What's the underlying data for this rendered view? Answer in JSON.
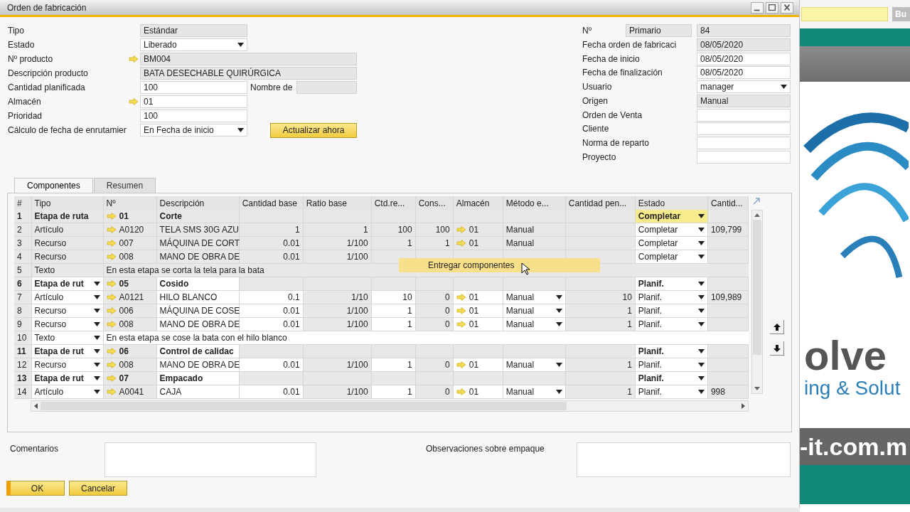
{
  "window": {
    "title": "Orden de fabricación"
  },
  "header_left": [
    {
      "label": "Tipo",
      "value": "Estándar",
      "editable": false
    },
    {
      "label": "Estado",
      "value": "Liberado",
      "editable": true,
      "dropdown": true
    },
    {
      "label": "Nº producto",
      "value": "BM004",
      "editable": false,
      "link": true,
      "wide": true
    },
    {
      "label": "Descripción producto",
      "value": "BATA DESECHABLE QUIRÚRGICA",
      "editable": false,
      "wide": true
    },
    {
      "label": "Cantidad planificada",
      "value": "100",
      "editable": true,
      "extra_label": "Nombre de"
    },
    {
      "label": "Almacén",
      "value": "01",
      "editable": true,
      "link": true
    },
    {
      "label": "Prioridad",
      "value": "100",
      "editable": true
    },
    {
      "label": "Cálculo de fecha de enrutamier",
      "value": "En Fecha de inicio",
      "editable": true,
      "dropdown": true,
      "button": "Actualizar ahora"
    }
  ],
  "header_right": [
    {
      "label": "Nº",
      "series": "Primario",
      "value": "84",
      "editable": false
    },
    {
      "label": "Fecha orden de fabricaci",
      "value": "08/05/2020",
      "editable": false
    },
    {
      "label": "Fecha de inicio",
      "value": "08/05/2020",
      "editable": true
    },
    {
      "label": "Fecha de finalización",
      "value": "08/05/2020",
      "editable": true
    },
    {
      "label": "Usuario",
      "value": "manager",
      "editable": true,
      "dropdown": true
    },
    {
      "label": "Origen",
      "value": "Manual",
      "editable": false
    },
    {
      "label": "Orden de Venta",
      "editable": true
    },
    {
      "label": "Cliente",
      "editable": true
    },
    {
      "label": "Norma de reparto",
      "editable": true
    },
    {
      "label": "Proyecto",
      "editable": true
    }
  ],
  "tabs": [
    {
      "label": "Componentes",
      "selected": true
    },
    {
      "label": "Resumen",
      "selected": false
    }
  ],
  "table": {
    "columns": [
      "#",
      "Tipo",
      "Nº",
      "Descripción",
      "Cantidad base",
      "Ratio base",
      "Ctd.re...",
      "Cons...",
      "Almacén",
      "Método e...",
      "Cantidad pen...",
      "Estado",
      "Cantid..."
    ],
    "rows": [
      {
        "kind": "stage",
        "editable": false,
        "highlighted": true,
        "num": "1",
        "type": "Etapa de ruta",
        "no": "01",
        "description": "Corte",
        "status": "Completar"
      },
      {
        "kind": "item",
        "editable": false,
        "num": "2",
        "type": "Artículo",
        "no": "A0120",
        "description": "TELA SMS 30G AZU",
        "base_qty": "1",
        "base_ratio": "1",
        "planned_qty": "100",
        "consumed": "100",
        "warehouse": "01",
        "method": "Manual",
        "status": "Completar",
        "quantity": "109,799"
      },
      {
        "kind": "item",
        "editable": false,
        "num": "3",
        "type": "Recurso",
        "no": "007",
        "description": "MÁQUINA DE CORT",
        "base_qty": "0.01",
        "base_ratio": "1/100",
        "planned_qty": "1",
        "consumed": "1",
        "warehouse": "01",
        "method": "Manual",
        "status": "Completar"
      },
      {
        "kind": "item",
        "editable": false,
        "num": "4",
        "type": "Recurso",
        "no": "008",
        "description": "MANO DE OBRA DE",
        "base_qty": "0.01",
        "base_ratio": "1/100",
        "status": "Completar"
      },
      {
        "kind": "text",
        "editable": false,
        "num": "5",
        "type": "Texto",
        "description": "En esta etapa se corta la tela para la bata"
      },
      {
        "kind": "stage",
        "editable": true,
        "num": "6",
        "type": "Etapa de rut",
        "no": "05",
        "description": "Cosido",
        "status": "Planif."
      },
      {
        "kind": "item",
        "editable": true,
        "num": "7",
        "type": "Artículo",
        "no": "A0121",
        "description": "HILO BLANCO",
        "base_qty": "0.1",
        "base_ratio": "1/10",
        "planned_qty": "10",
        "consumed": "0",
        "warehouse": "01",
        "method": "Manual",
        "pending": "10",
        "status": "Planif.",
        "quantity": "109,989"
      },
      {
        "kind": "item",
        "editable": true,
        "num": "8",
        "type": "Recurso",
        "no": "006",
        "description": "MÁQUINA DE COSE",
        "base_qty": "0.01",
        "base_ratio": "1/100",
        "planned_qty": "1",
        "consumed": "0",
        "warehouse": "01",
        "method": "Manual",
        "pending": "1",
        "status": "Planif."
      },
      {
        "kind": "item",
        "editable": true,
        "num": "9",
        "type": "Recurso",
        "no": "008",
        "description": "MANO DE OBRA DE",
        "base_qty": "0.01",
        "base_ratio": "1/100",
        "planned_qty": "1",
        "consumed": "0",
        "warehouse": "01",
        "method": "Manual",
        "pending": "1",
        "status": "Planif."
      },
      {
        "kind": "text",
        "editable": true,
        "num": "10",
        "type": "Texto",
        "description": "En esta etapa se cose la bata con el hilo blanco"
      },
      {
        "kind": "stage",
        "editable": true,
        "num": "11",
        "type": "Etapa de rut",
        "no": "06",
        "description": "Control de calidac",
        "status": "Planif."
      },
      {
        "kind": "item",
        "editable": true,
        "num": "12",
        "type": "Recurso",
        "no": "008",
        "description": "MANO DE OBRA DE",
        "base_qty": "0.01",
        "base_ratio": "1/100",
        "planned_qty": "1",
        "consumed": "0",
        "warehouse": "01",
        "method": "Manual",
        "pending": "1",
        "status": "Planif."
      },
      {
        "kind": "stage",
        "editable": true,
        "num": "13",
        "type": "Etapa de rut",
        "no": "07",
        "description": "Empacado",
        "status": "Planif."
      },
      {
        "kind": "item",
        "editable": true,
        "num": "14",
        "type": "Artículo",
        "no": "A0041",
        "description": "CAJA",
        "base_qty": "0.01",
        "base_ratio": "1/100",
        "planned_qty": "1",
        "consumed": "0",
        "warehouse": "01",
        "method": "Manual",
        "pending": "1",
        "status": "Planif.",
        "quantity": "998"
      }
    ]
  },
  "context_menu": {
    "items": [
      "Entregar componentes"
    ]
  },
  "footer": {
    "comments_label": "Comentarios",
    "packing_label": "Observaciones sobre empaque",
    "buttons": [
      {
        "label": "OK",
        "kind": "primary"
      },
      {
        "label": "Cancelar",
        "kind": "secondary"
      }
    ]
  },
  "background": {
    "search_button": "Bu",
    "texts": [
      {
        "text": "olve",
        "kind": "large"
      },
      {
        "text": "ing & Solut",
        "kind": "tagline"
      },
      {
        "text": "-it.com.m",
        "kind": "url"
      }
    ]
  }
}
